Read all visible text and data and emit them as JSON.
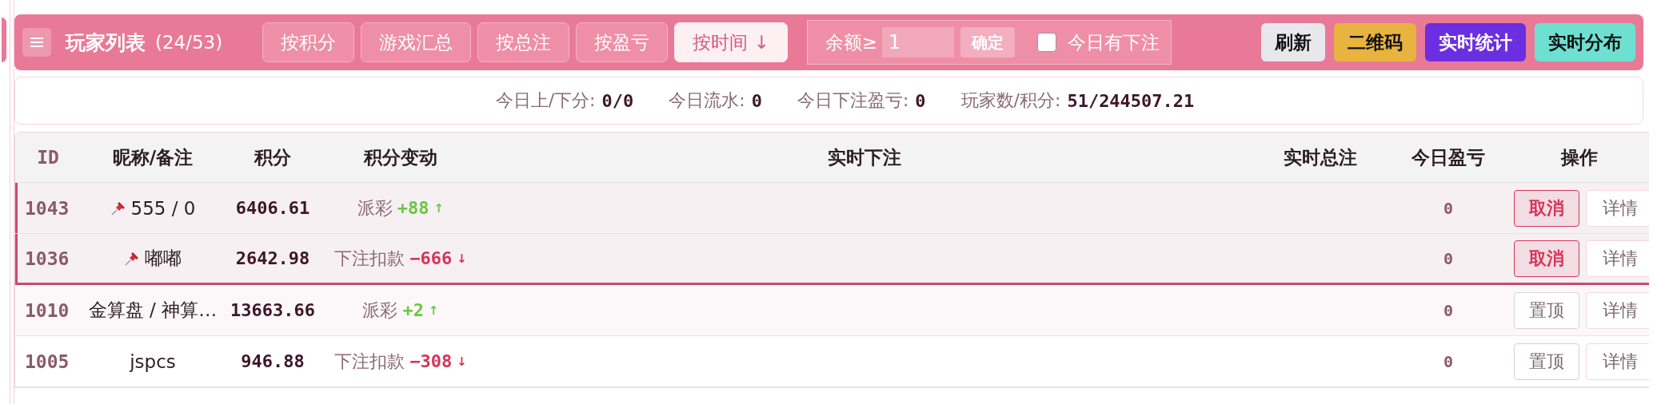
{
  "toolbar": {
    "title": "玩家列表",
    "count": "(24/53)",
    "sort_buttons": [
      {
        "label": "按积分",
        "selected": false
      },
      {
        "label": "游戏汇总",
        "selected": false
      },
      {
        "label": "按总注",
        "selected": false
      },
      {
        "label": "按盈亏",
        "selected": false
      },
      {
        "label": "按时间 ↓",
        "selected": true
      }
    ],
    "filter": {
      "label": "余额≥",
      "value": "1",
      "confirm": "确定",
      "checkbox": {
        "label": "今日有下注",
        "checked": false
      }
    },
    "actions": [
      {
        "label": "刷新",
        "color": "#e8e8ec"
      },
      {
        "label": "二维码",
        "color": "#e8b33f"
      },
      {
        "label": "实时统计",
        "color": "#6b2ee0"
      },
      {
        "label": "实时分布",
        "color": "#6ee0d2"
      }
    ]
  },
  "stats": [
    {
      "label": "今日上/下分:",
      "value": "0/0"
    },
    {
      "label": "今日流水:",
      "value": "0"
    },
    {
      "label": "今日下注盈亏:",
      "value": "0"
    },
    {
      "label": "玩家数/积分:",
      "value": "51/244507.21"
    }
  ],
  "table": {
    "columns": [
      "ID",
      "昵称/备注",
      "积分",
      "积分变动",
      "实时下注",
      "实时总注",
      "今日盈亏",
      "操作"
    ],
    "rows": [
      {
        "id": "1043",
        "pinned": true,
        "nickname": "555 / 0",
        "points": "6406.61",
        "change": {
          "label": "派彩",
          "amount": "+88",
          "arrow": "↑",
          "kind": "gain"
        },
        "today": "0",
        "action": "取消",
        "details": "详情"
      },
      {
        "id": "1036",
        "pinned": true,
        "nickname": "嘟嘟",
        "points": "2642.98",
        "change": {
          "label": "下注扣款",
          "amount": "−666",
          "arrow": "↓",
          "kind": "loss"
        },
        "today": "0",
        "action": "取消",
        "details": "详情"
      },
      {
        "id": "1010",
        "pinned": false,
        "nickname": "金算盘 / 神算…",
        "points": "13663.66",
        "change": {
          "label": "派彩",
          "amount": "+2",
          "arrow": "↑",
          "kind": "gain"
        },
        "today": "0",
        "action": "置顶",
        "details": "详情"
      },
      {
        "id": "1005",
        "pinned": false,
        "nickname": "jspcs",
        "points": "946.88",
        "change": {
          "label": "下注扣款",
          "amount": "−308",
          "arrow": "↓",
          "kind": "loss"
        },
        "today": "0",
        "action": "置顶",
        "details": "详情"
      }
    ]
  }
}
